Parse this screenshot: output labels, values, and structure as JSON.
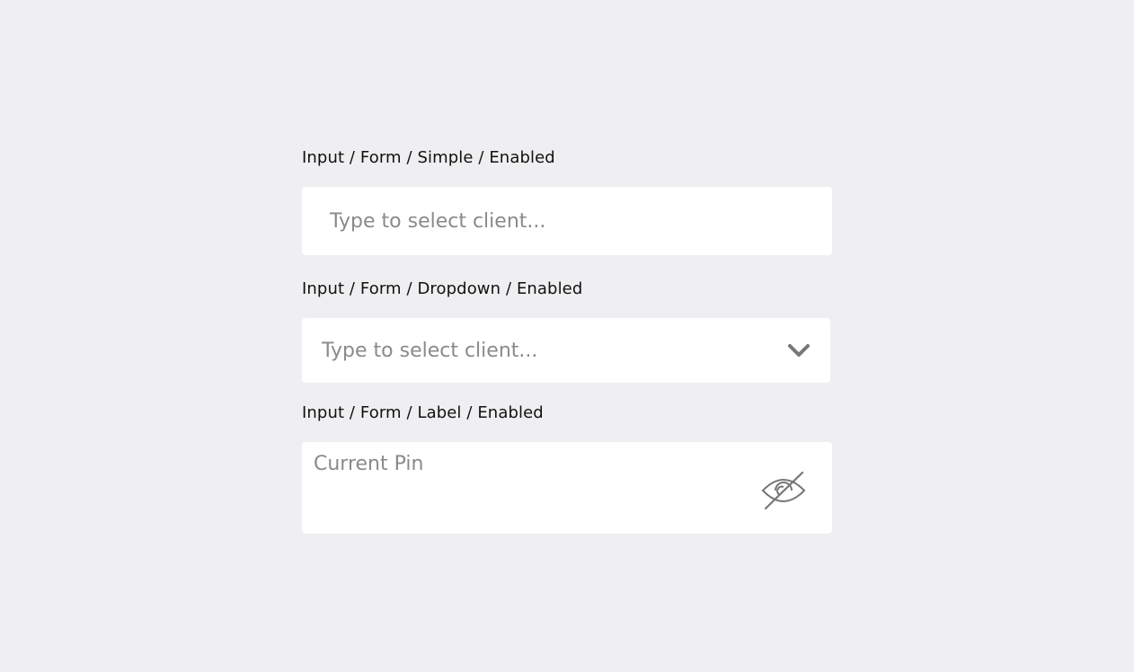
{
  "sections": {
    "simple": {
      "label": "Input / Form / Simple / Enabled",
      "placeholder": "Type to select client..."
    },
    "dropdown": {
      "label": "Input / Form / Dropdown / Enabled",
      "placeholder": "Type to select client...",
      "icon": "chevron-down-icon"
    },
    "label_field": {
      "label": "Input / Form / Label / Enabled",
      "placeholder": "Current Pin",
      "icon": "eye-off-icon"
    }
  },
  "colors": {
    "background": "#efeff1",
    "field_background": "#ffffff",
    "placeholder": "#8a8a8a",
    "icon": "#777777",
    "label_text": "#111111"
  }
}
